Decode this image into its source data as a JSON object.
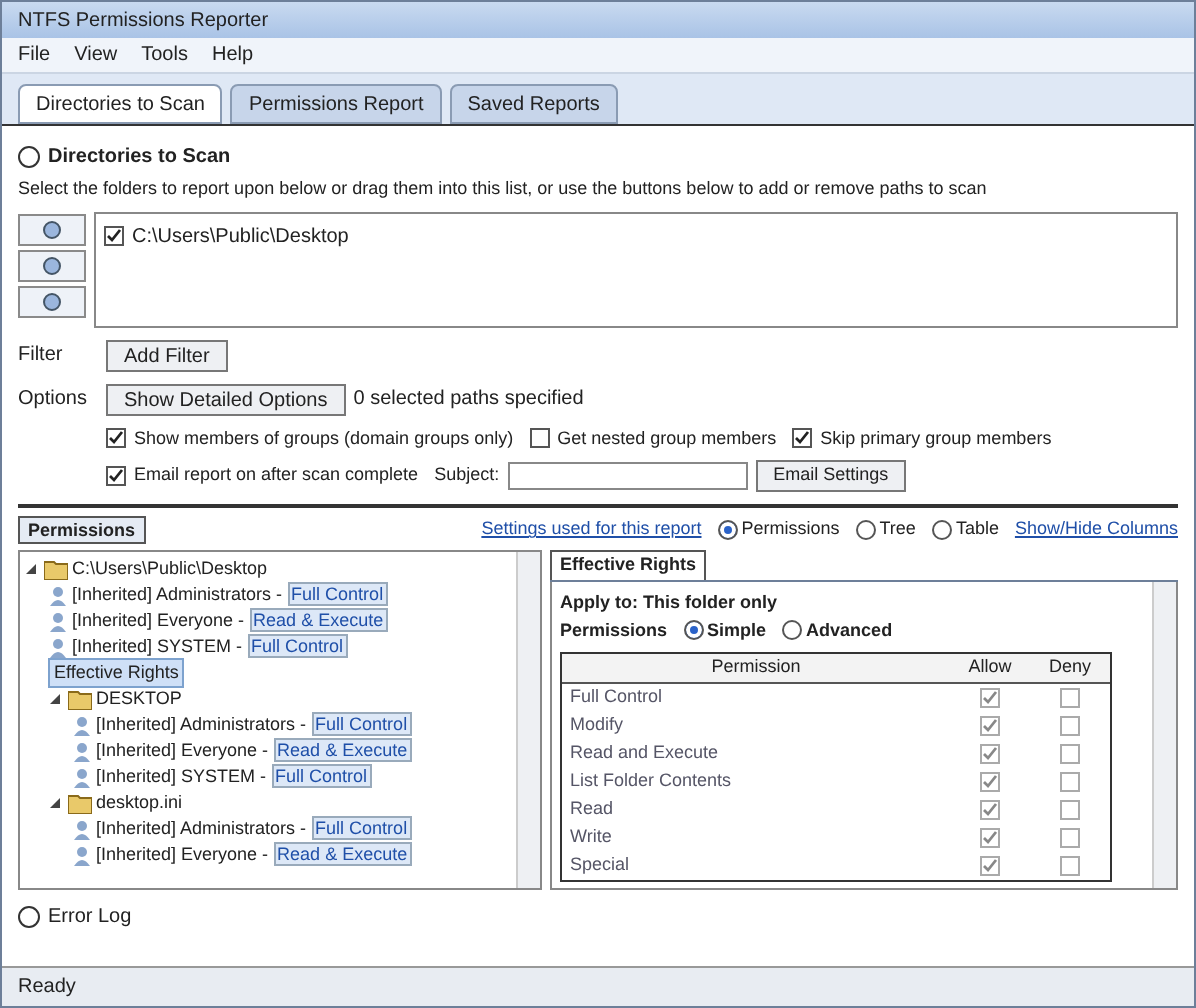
{
  "window": {
    "title": "NTFS Permissions Reporter"
  },
  "menu": [
    "File",
    "View",
    "Tools",
    "Help"
  ],
  "toolbar": [
    {
      "label": "Directories to Scan",
      "selected": true
    },
    {
      "label": "Permissions Report",
      "selected": false
    },
    {
      "label": "Saved Reports",
      "selected": false
    }
  ],
  "scan": {
    "title": "Directories to Scan",
    "description": "Select the folders to report upon below or drag them into this list, or use the buttons below to add or remove paths to scan",
    "paths": [
      {
        "label": "C:\\Users\\Public\\Desktop",
        "checked": true
      }
    ],
    "filter_label": "Filter",
    "filter_button": "Add Filter",
    "options_label": "Options",
    "options_button": "Show Detailed Options",
    "options_note": "0 selected paths specified",
    "checks": [
      {
        "label": "Show members of groups (domain groups only)",
        "checked": true
      },
      {
        "label": "Get nested group members",
        "checked": false
      },
      {
        "label": "Skip primary group members",
        "checked": true
      }
    ],
    "email": {
      "label": "Email report on after scan complete",
      "checked": true,
      "subject_label": "Subject:",
      "button": "Email Settings"
    }
  },
  "results": {
    "tab": "Permissions",
    "settings_link": "Settings used for this report",
    "views": [
      {
        "label": "Permissions",
        "selected": true
      },
      {
        "label": "Tree",
        "selected": false
      },
      {
        "label": "Table",
        "selected": false
      }
    ],
    "columns_link": "Show/Hide Columns",
    "tree": [
      {
        "label": "C:\\Users\\Public\\Desktop",
        "expanded": true,
        "children": [
          {
            "label": "[Inherited] Administrators - ",
            "rights": "Full Control"
          },
          {
            "label": "[Inherited] Everyone - ",
            "rights": "Read & Execute"
          },
          {
            "label": "[Inherited] SYSTEM - ",
            "rights": "Full Control"
          },
          {
            "label": "Effective Rights",
            "selected": true
          },
          {
            "label": "DESKTOP",
            "expanded": true,
            "children": [
              {
                "label": "[Inherited] Administrators - ",
                "rights": "Full Control"
              },
              {
                "label": "[Inherited] Everyone - ",
                "rights": "Read & Execute"
              },
              {
                "label": "[Inherited] SYSTEM - ",
                "rights": "Full Control"
              }
            ]
          },
          {
            "label": "desktop.ini",
            "expanded": true,
            "children": [
              {
                "label": "[Inherited] Administrators - ",
                "rights": "Full Control"
              },
              {
                "label": "[Inherited] Everyone - ",
                "rights": "Read & Execute"
              }
            ]
          }
        ]
      }
    ],
    "detail_tab": "Effective Rights",
    "apply_to": "Apply to: This folder only",
    "perm_label": "Permissions",
    "perm_modes": [
      {
        "label": "Simple",
        "selected": true
      },
      {
        "label": "Advanced",
        "selected": false
      }
    ],
    "perm_columns": [
      "Permission",
      "Allow",
      "Deny"
    ],
    "perms": [
      {
        "name": "Full Control",
        "allow": true,
        "deny": false
      },
      {
        "name": "Modify",
        "allow": true,
        "deny": false
      },
      {
        "name": "Read and Execute",
        "allow": true,
        "deny": false
      },
      {
        "name": "List Folder Contents",
        "allow": true,
        "deny": false
      },
      {
        "name": "Read",
        "allow": true,
        "deny": false
      },
      {
        "name": "Write",
        "allow": true,
        "deny": false
      },
      {
        "name": "Special",
        "allow": true,
        "deny": false
      }
    ]
  },
  "error_log": "Error Log",
  "status_bar": "Ready"
}
